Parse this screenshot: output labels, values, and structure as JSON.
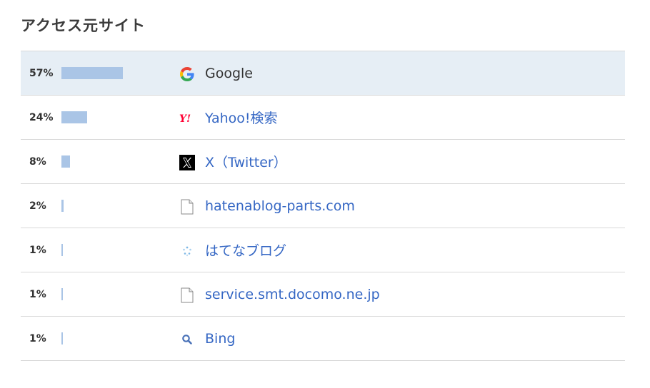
{
  "heading": "アクセス元サイト",
  "rows": [
    {
      "percent": "57%",
      "value": 57,
      "name": "Google",
      "icon": "google-icon",
      "highlight": true,
      "link_color": "#333333"
    },
    {
      "percent": "24%",
      "value": 24,
      "name": "Yahoo!検索",
      "icon": "yahoo-icon",
      "highlight": false,
      "link_color": "#3567c4"
    },
    {
      "percent": "8%",
      "value": 8,
      "name": "X（Twitter）",
      "icon": "x-icon",
      "highlight": false,
      "link_color": "#3567c4"
    },
    {
      "percent": "2%",
      "value": 2,
      "name": "hatenablog-parts.com",
      "icon": "document-icon",
      "highlight": false,
      "link_color": "#3567c4"
    },
    {
      "percent": "1%",
      "value": 1,
      "name": "はてなブログ",
      "icon": "hatena-blog-icon",
      "highlight": false,
      "link_color": "#3567c4"
    },
    {
      "percent": "1%",
      "value": 1,
      "name": "service.smt.docomo.ne.jp",
      "icon": "document-icon",
      "highlight": false,
      "link_color": "#3567c4"
    },
    {
      "percent": "1%",
      "value": 1,
      "name": "Bing",
      "icon": "search-icon",
      "highlight": false,
      "link_color": "#3567c4"
    }
  ],
  "colors": {
    "bar": "#aac5e6",
    "highlight_bg": "#e6eef5",
    "link": "#3567c4"
  }
}
